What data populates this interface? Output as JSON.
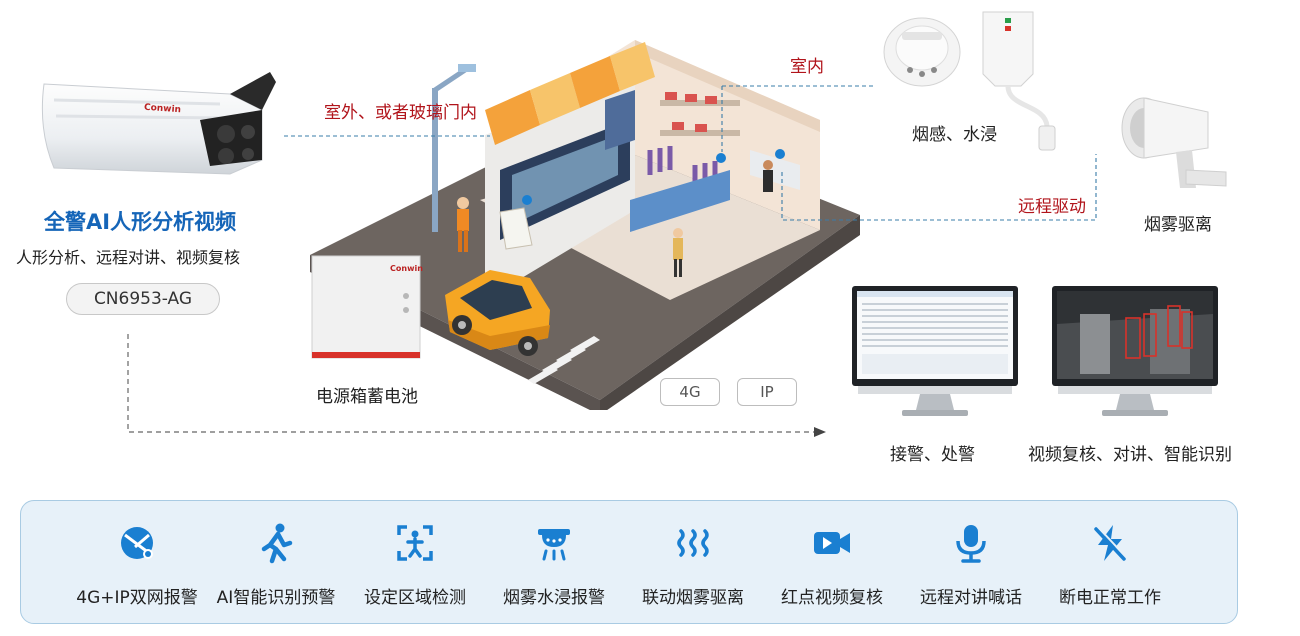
{
  "camera": {
    "brand": "Conwin",
    "title": "全警AI人形分析视频",
    "subtitle": "人形分析、远程对讲、视频复核",
    "model": "CN6953-AG"
  },
  "scene": {
    "outdoor_label": "室外、或者玻璃门内",
    "indoor_label": "室内",
    "remote_drive_label": "远程驱动",
    "power_box_label": "电源箱蓄电池",
    "power_box_brand": "Conwin"
  },
  "devices": {
    "smoke_water_label": "烟感、水浸",
    "fog_label": "烟雾驱离"
  },
  "network": {
    "tag_4g": "4G",
    "tag_ip": "IP"
  },
  "monitors": {
    "left_label": "接警、处警",
    "right_label": "视频复核、对讲、智能识别"
  },
  "features": [
    {
      "label": "4G+IP双网报警",
      "icon": "dual-network-icon"
    },
    {
      "label": "AI智能识别预警",
      "icon": "running-person-icon"
    },
    {
      "label": "设定区域检测",
      "icon": "area-detect-icon"
    },
    {
      "label": "烟雾水浸报警",
      "icon": "smoke-water-icon"
    },
    {
      "label": "联动烟雾驱离",
      "icon": "heat-waves-icon"
    },
    {
      "label": "红点视频复核",
      "icon": "video-camera-icon"
    },
    {
      "label": "远程对讲喊话",
      "icon": "microphone-icon"
    },
    {
      "label": "断电正常工作",
      "icon": "power-cut-icon"
    }
  ],
  "colors": {
    "accent_blue": "#1a7fd1",
    "title_blue": "#1565b8",
    "label_red": "#b1141b"
  }
}
